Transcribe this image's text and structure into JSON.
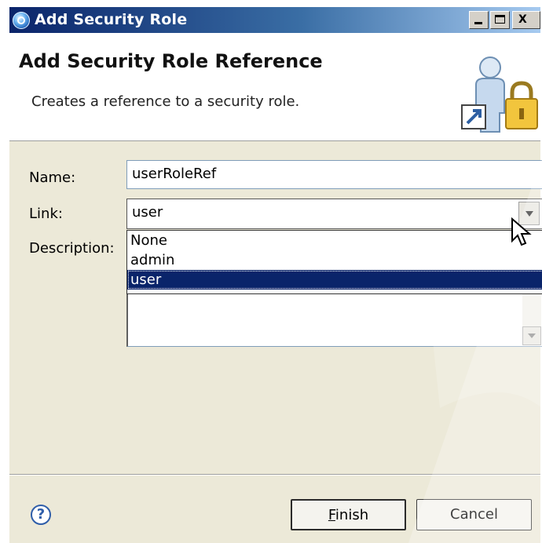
{
  "window": {
    "title": "Add Security Role",
    "controls": {
      "minimize": "_",
      "maximize": "□",
      "close": "X"
    }
  },
  "banner": {
    "title": "Add Security Role Reference",
    "description": "Creates a reference to a security role.",
    "icon": "user-lock-icon"
  },
  "form": {
    "name_label": "Name:",
    "name_value": "userRoleRef",
    "link_label": "Link:",
    "link_value": "user",
    "description_label": "Description:",
    "link_options": [
      "None",
      "admin",
      "user"
    ],
    "selected_option": "user"
  },
  "footer": {
    "help_icon": "help-icon",
    "finish_label_prefix": "",
    "finish_mnemonic": "F",
    "finish_label_rest": "inish",
    "cancel_label": "Cancel"
  },
  "colors": {
    "title_bar": "#0a246a",
    "selection": "#0a246a",
    "dialog_bg": "#ece9d8"
  }
}
